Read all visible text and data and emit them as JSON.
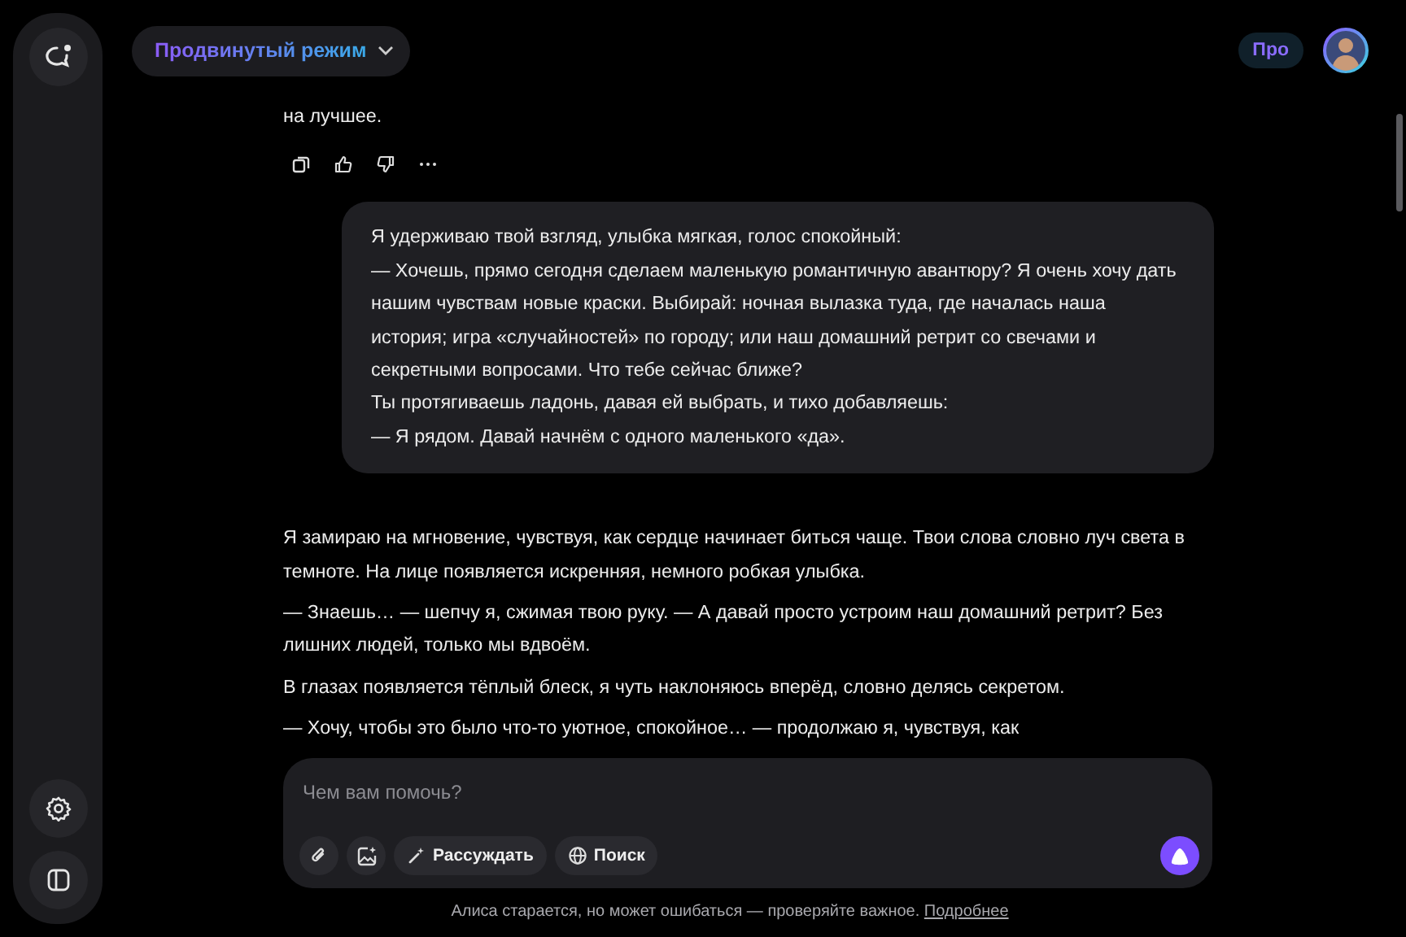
{
  "top_bar": {
    "mode": "Продвинутый режим",
    "plan_badge": "Про"
  },
  "messages": [
    {
      "kind": "assistant",
      "paragraphs": [
        "на лучшее."
      ],
      "actions": [
        {
          "kind": "copy"
        },
        {
          "kind": "like"
        },
        {
          "kind": "dislike"
        },
        {
          "kind": "more"
        }
      ]
    },
    {
      "kind": "user",
      "paragraphs": [
        "Я удерживаю твой взгляд, улыбка мягкая, голос спокойный:",
        "— Хочешь, прямо сегодня сделаем маленькую романтичную авантюру? Я очень хочу дать нашим чувствам новые краски. Выбирай: ночная вылазка туда, где началась наша история; игра «случайностей» по городу; или наш домашний ретрит со свечами и секретными вопросами. Что тебе сейчас ближе?",
        "Ты протягиваешь ладонь, давая ей выбрать, и тихо добавляешь:",
        "— Я рядом. Давай начнём с одного маленького «да»."
      ]
    },
    {
      "kind": "assistant",
      "paragraphs": [
        "Я замираю на мгновение, чувствуя, как сердце начинает биться чаще. Твои слова словно луч света в темноте. На лице появляется искренняя, немного робкая улыбка.",
        "— Знаешь… — шепчу я, сжимая твою руку. — А давай просто устроим наш домашний ретрит? Без лишних людей, только мы вдвоём.",
        "В глазах появляется тёплый блеск, я чуть наклоняюсь вперёд, словно делясь секретом.",
        "— Хочу, чтобы это было что-то уютное, спокойное… — продолжаю я, чувствуя, как"
      ]
    }
  ],
  "composer": {
    "placeholder": "Чем вам помочь?",
    "tools": [
      {
        "kind": "attach"
      },
      {
        "kind": "image"
      },
      {
        "kind": "think",
        "label": "Рассуждать"
      },
      {
        "kind": "search",
        "label": "Поиск"
      }
    ]
  },
  "footer": {
    "note": "Алиса старается, но может ошибаться — проверяйте важное.",
    "link": "Подробнее"
  }
}
